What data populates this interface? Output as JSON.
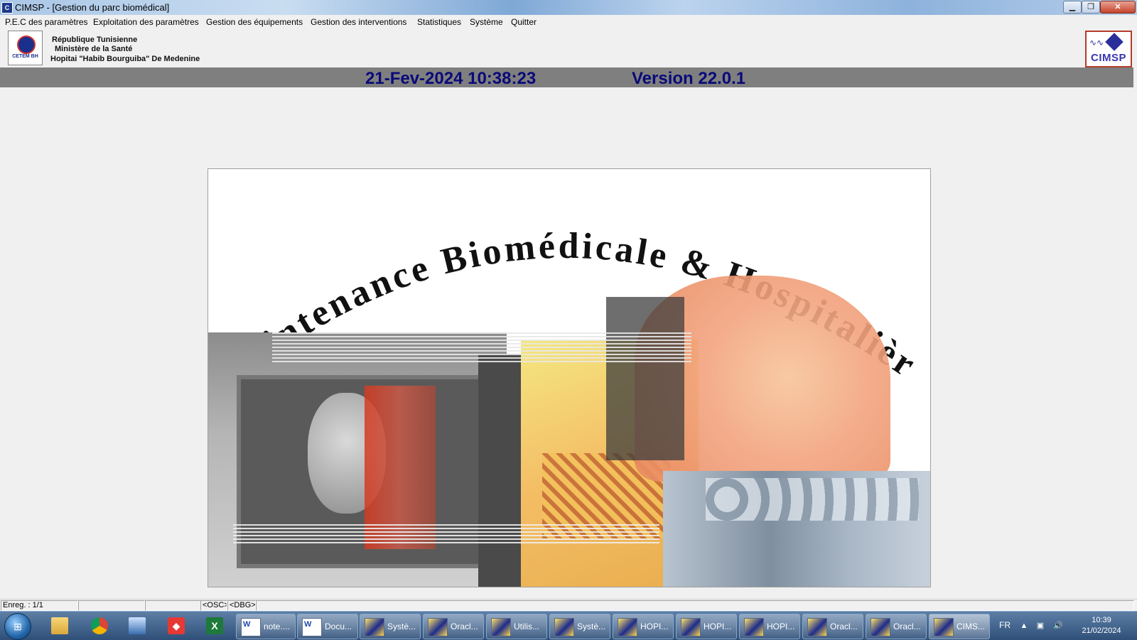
{
  "window": {
    "title": "CIMSP - [Gestion du parc biomédical]",
    "app_icon": "cimsp-app-icon"
  },
  "menu": [
    "P.E.C des paramètres",
    "Exploitation des paramètres",
    "Gestion des équipements",
    "Gestion des interventions",
    "Statistiques",
    "Système",
    "Quitter"
  ],
  "header": {
    "line1": "République Tunisienne",
    "line2": "Ministère de la Santé",
    "line3": "Hopitai \"Habib Bourguiba\" De Medenine",
    "left_logo_text": "CETEM BH",
    "right_logo_text": "CIMSP"
  },
  "datebar": {
    "datetime": "21-Fev-2024 10:38:23",
    "version": "Version 22.0.1"
  },
  "splash": {
    "title": "Maintenance Biomédicale & Hospitalière"
  },
  "statusbar": {
    "record": "Enreg. : 1/1",
    "osc": "<OSC>",
    "dbg": "<DBG>"
  },
  "taskbar": {
    "items": [
      {
        "label": "note....",
        "icon": "word-doc-icon"
      },
      {
        "label": "Docu...",
        "icon": "word-doc-icon"
      },
      {
        "label": "Systè...",
        "icon": "oracle-forms-icon"
      },
      {
        "label": "Oracl...",
        "icon": "oracle-forms-icon"
      },
      {
        "label": "Utilis...",
        "icon": "oracle-forms-icon"
      },
      {
        "label": "Systè...",
        "icon": "oracle-forms-icon"
      },
      {
        "label": "HOPI...",
        "icon": "oracle-forms-icon"
      },
      {
        "label": "HOPI...",
        "icon": "oracle-forms-icon"
      },
      {
        "label": "HOPI...",
        "icon": "oracle-forms-icon"
      },
      {
        "label": "Oracl...",
        "icon": "oracle-forms-icon"
      },
      {
        "label": "Oracl...",
        "icon": "oracle-forms-icon"
      },
      {
        "label": "CIMS...",
        "icon": "oracle-forms-icon"
      }
    ],
    "lang": "FR",
    "time": "10:39",
    "date": "21/02/2024"
  },
  "colors": {
    "datebar_bg": "#7f7f7f",
    "date_text": "#0a0a7a",
    "taskbar": "#3d6190"
  }
}
